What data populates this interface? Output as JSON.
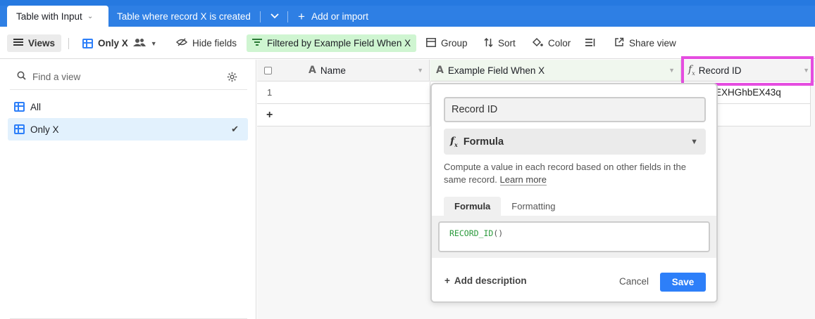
{
  "tabs": {
    "active": "Table with Input",
    "second": "Table where record X is created",
    "add_import": "Add or import"
  },
  "toolbar": {
    "views": "Views",
    "view_name": "Only X",
    "hide_fields": "Hide fields",
    "filter": "Filtered by Example Field When X",
    "group": "Group",
    "sort": "Sort",
    "color": "Color",
    "share": "Share view"
  },
  "sidebar": {
    "search_placeholder": "Find a view",
    "items": [
      {
        "label": "All"
      },
      {
        "label": "Only X"
      }
    ]
  },
  "grid": {
    "columns": [
      "Name",
      "Example Field When X",
      "Record ID"
    ],
    "rows": [
      {
        "num": "1",
        "record_id": "EXHGhbEX43q"
      }
    ],
    "add_row": "+"
  },
  "field_popover": {
    "field_name": "Record ID",
    "field_type": "Formula",
    "description_text": "Compute a value in each record based on other fields in the same record.",
    "learn_more": "Learn more",
    "tab_formula": "Formula",
    "tab_formatting": "Formatting",
    "formula_fn": "RECORD_ID",
    "formula_parens": "()",
    "add_description": "Add description",
    "cancel": "Cancel",
    "save": "Save"
  },
  "colors": {
    "tabbar": "#2e7fe4",
    "accent": "#2d7ff9",
    "filter_bg": "#cff5d1",
    "highlight": "#e54de0"
  }
}
